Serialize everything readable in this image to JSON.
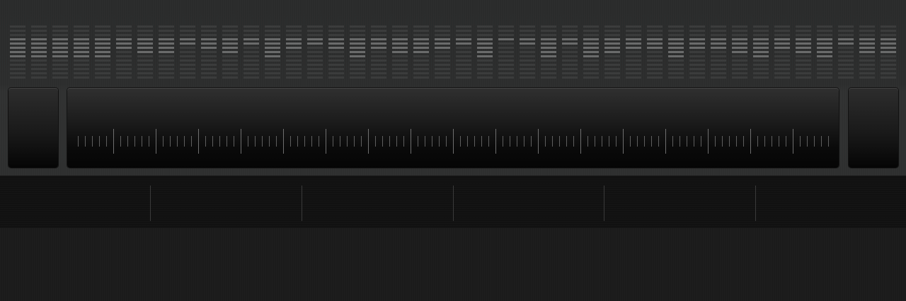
{
  "meters": {
    "count": 42,
    "segments": 13,
    "levels": [
      8,
      7,
      9,
      7,
      9,
      5,
      6,
      6,
      4,
      5,
      6,
      4,
      7,
      5,
      4,
      5,
      7,
      5,
      6,
      6,
      5,
      4,
      7,
      3,
      4,
      7,
      4,
      7,
      6,
      5,
      5,
      7,
      5,
      5,
      6,
      7,
      5,
      6,
      7,
      4,
      6,
      6
    ]
  },
  "transport": {
    "left_button_icon": "",
    "right_button_icon": ""
  },
  "ruler": {
    "major_ticks": 17,
    "minor_per_major": 5
  },
  "timeline": {
    "divisions": 6
  },
  "colors": {
    "meter_lit": "#6a6b6b",
    "meter_dim": "#3b3c3c",
    "tick": "#7a7a7a",
    "timeline_bg": "#111111"
  }
}
